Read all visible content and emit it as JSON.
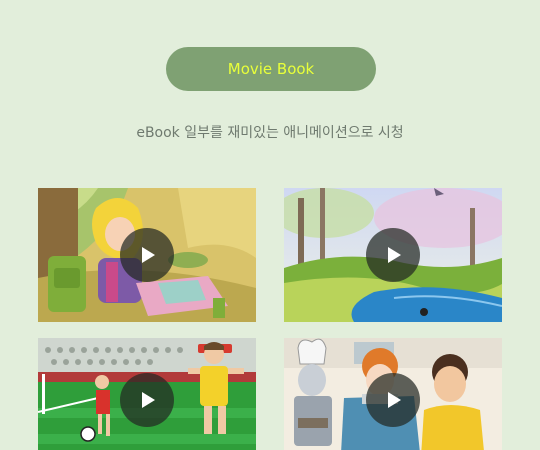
{
  "header": {
    "button_label": "Movie Book",
    "subtitle": "eBook 일부를 재미있는 애니메이션으로 시청"
  },
  "colors": {
    "background": "#e2eedb",
    "button_bg": "#7fa173",
    "button_text": "#e8ff3a",
    "subtitle_text": "#6f7a6f"
  },
  "videos": [
    {
      "icon": "play-icon"
    },
    {
      "icon": "play-icon"
    },
    {
      "icon": "play-icon"
    },
    {
      "icon": "play-icon"
    }
  ]
}
